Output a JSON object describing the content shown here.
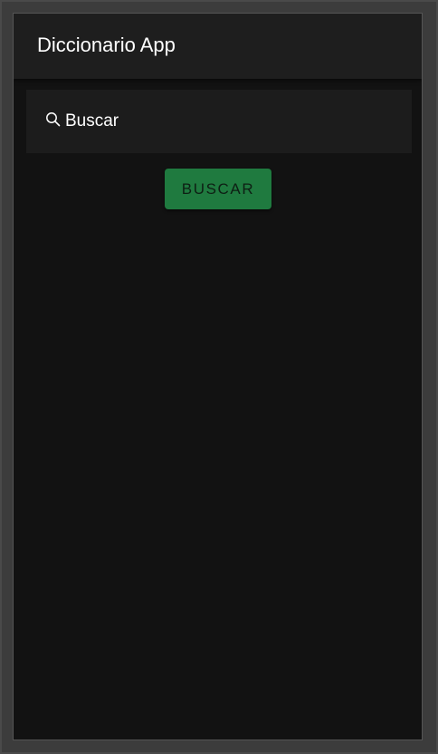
{
  "app_bar": {
    "title": "Diccionario App"
  },
  "search": {
    "placeholder": "Buscar",
    "value": "",
    "icon": "search-icon"
  },
  "actions": {
    "search_button_label": "BUSCAR"
  },
  "colors": {
    "background": "#121212",
    "app_bar": "#1e1e1e",
    "accent": "#1f7a3f",
    "text": "#ffffff"
  }
}
